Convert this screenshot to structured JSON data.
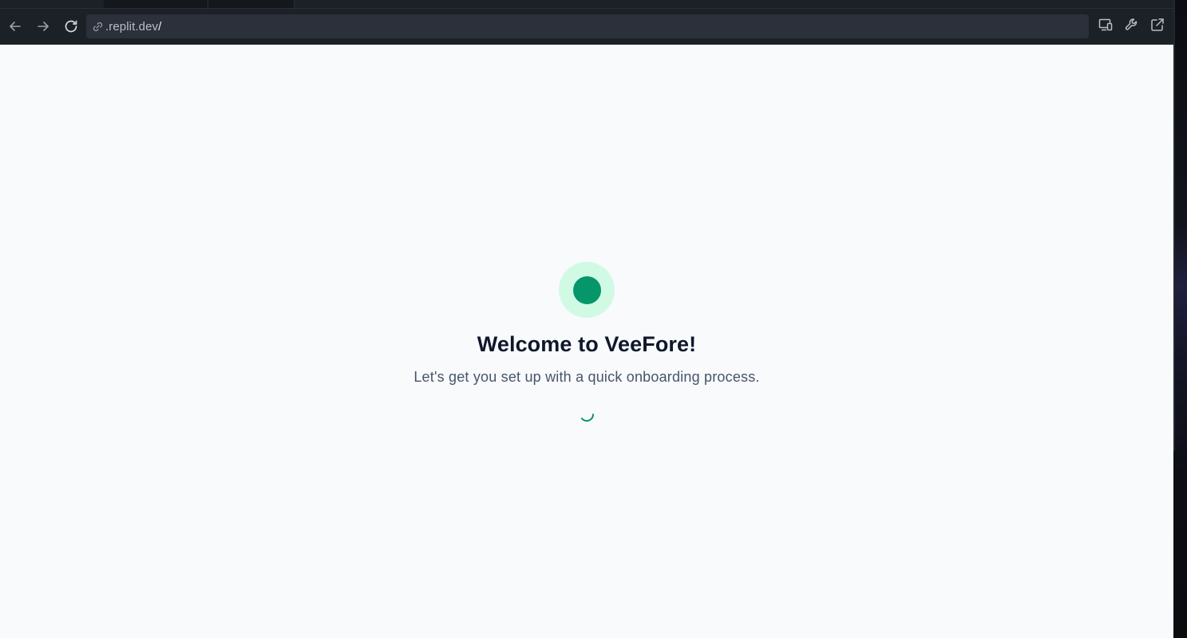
{
  "browser": {
    "url_host": ".replit.dev",
    "url_path": "/",
    "icons": {
      "back": "arrow-left-icon",
      "forward": "arrow-right-icon",
      "reload": "reload-icon",
      "url": "link-icon",
      "devices": "devices-icon",
      "devtools": "wrench-icon",
      "open_external": "external-link-icon"
    }
  },
  "onboarding": {
    "title": "Welcome to VeeFore!",
    "subtitle": "Let's get you set up with a quick onboarding process.",
    "loading_icon": "spinner-icon"
  },
  "colors": {
    "brand": "#059669",
    "brand_light": "#d1fae5",
    "page_background": "#f8fafc",
    "title": "#0f172a",
    "subtitle": "#475569",
    "toolbar": "#1c2027",
    "url_bar": "#2b303a"
  }
}
